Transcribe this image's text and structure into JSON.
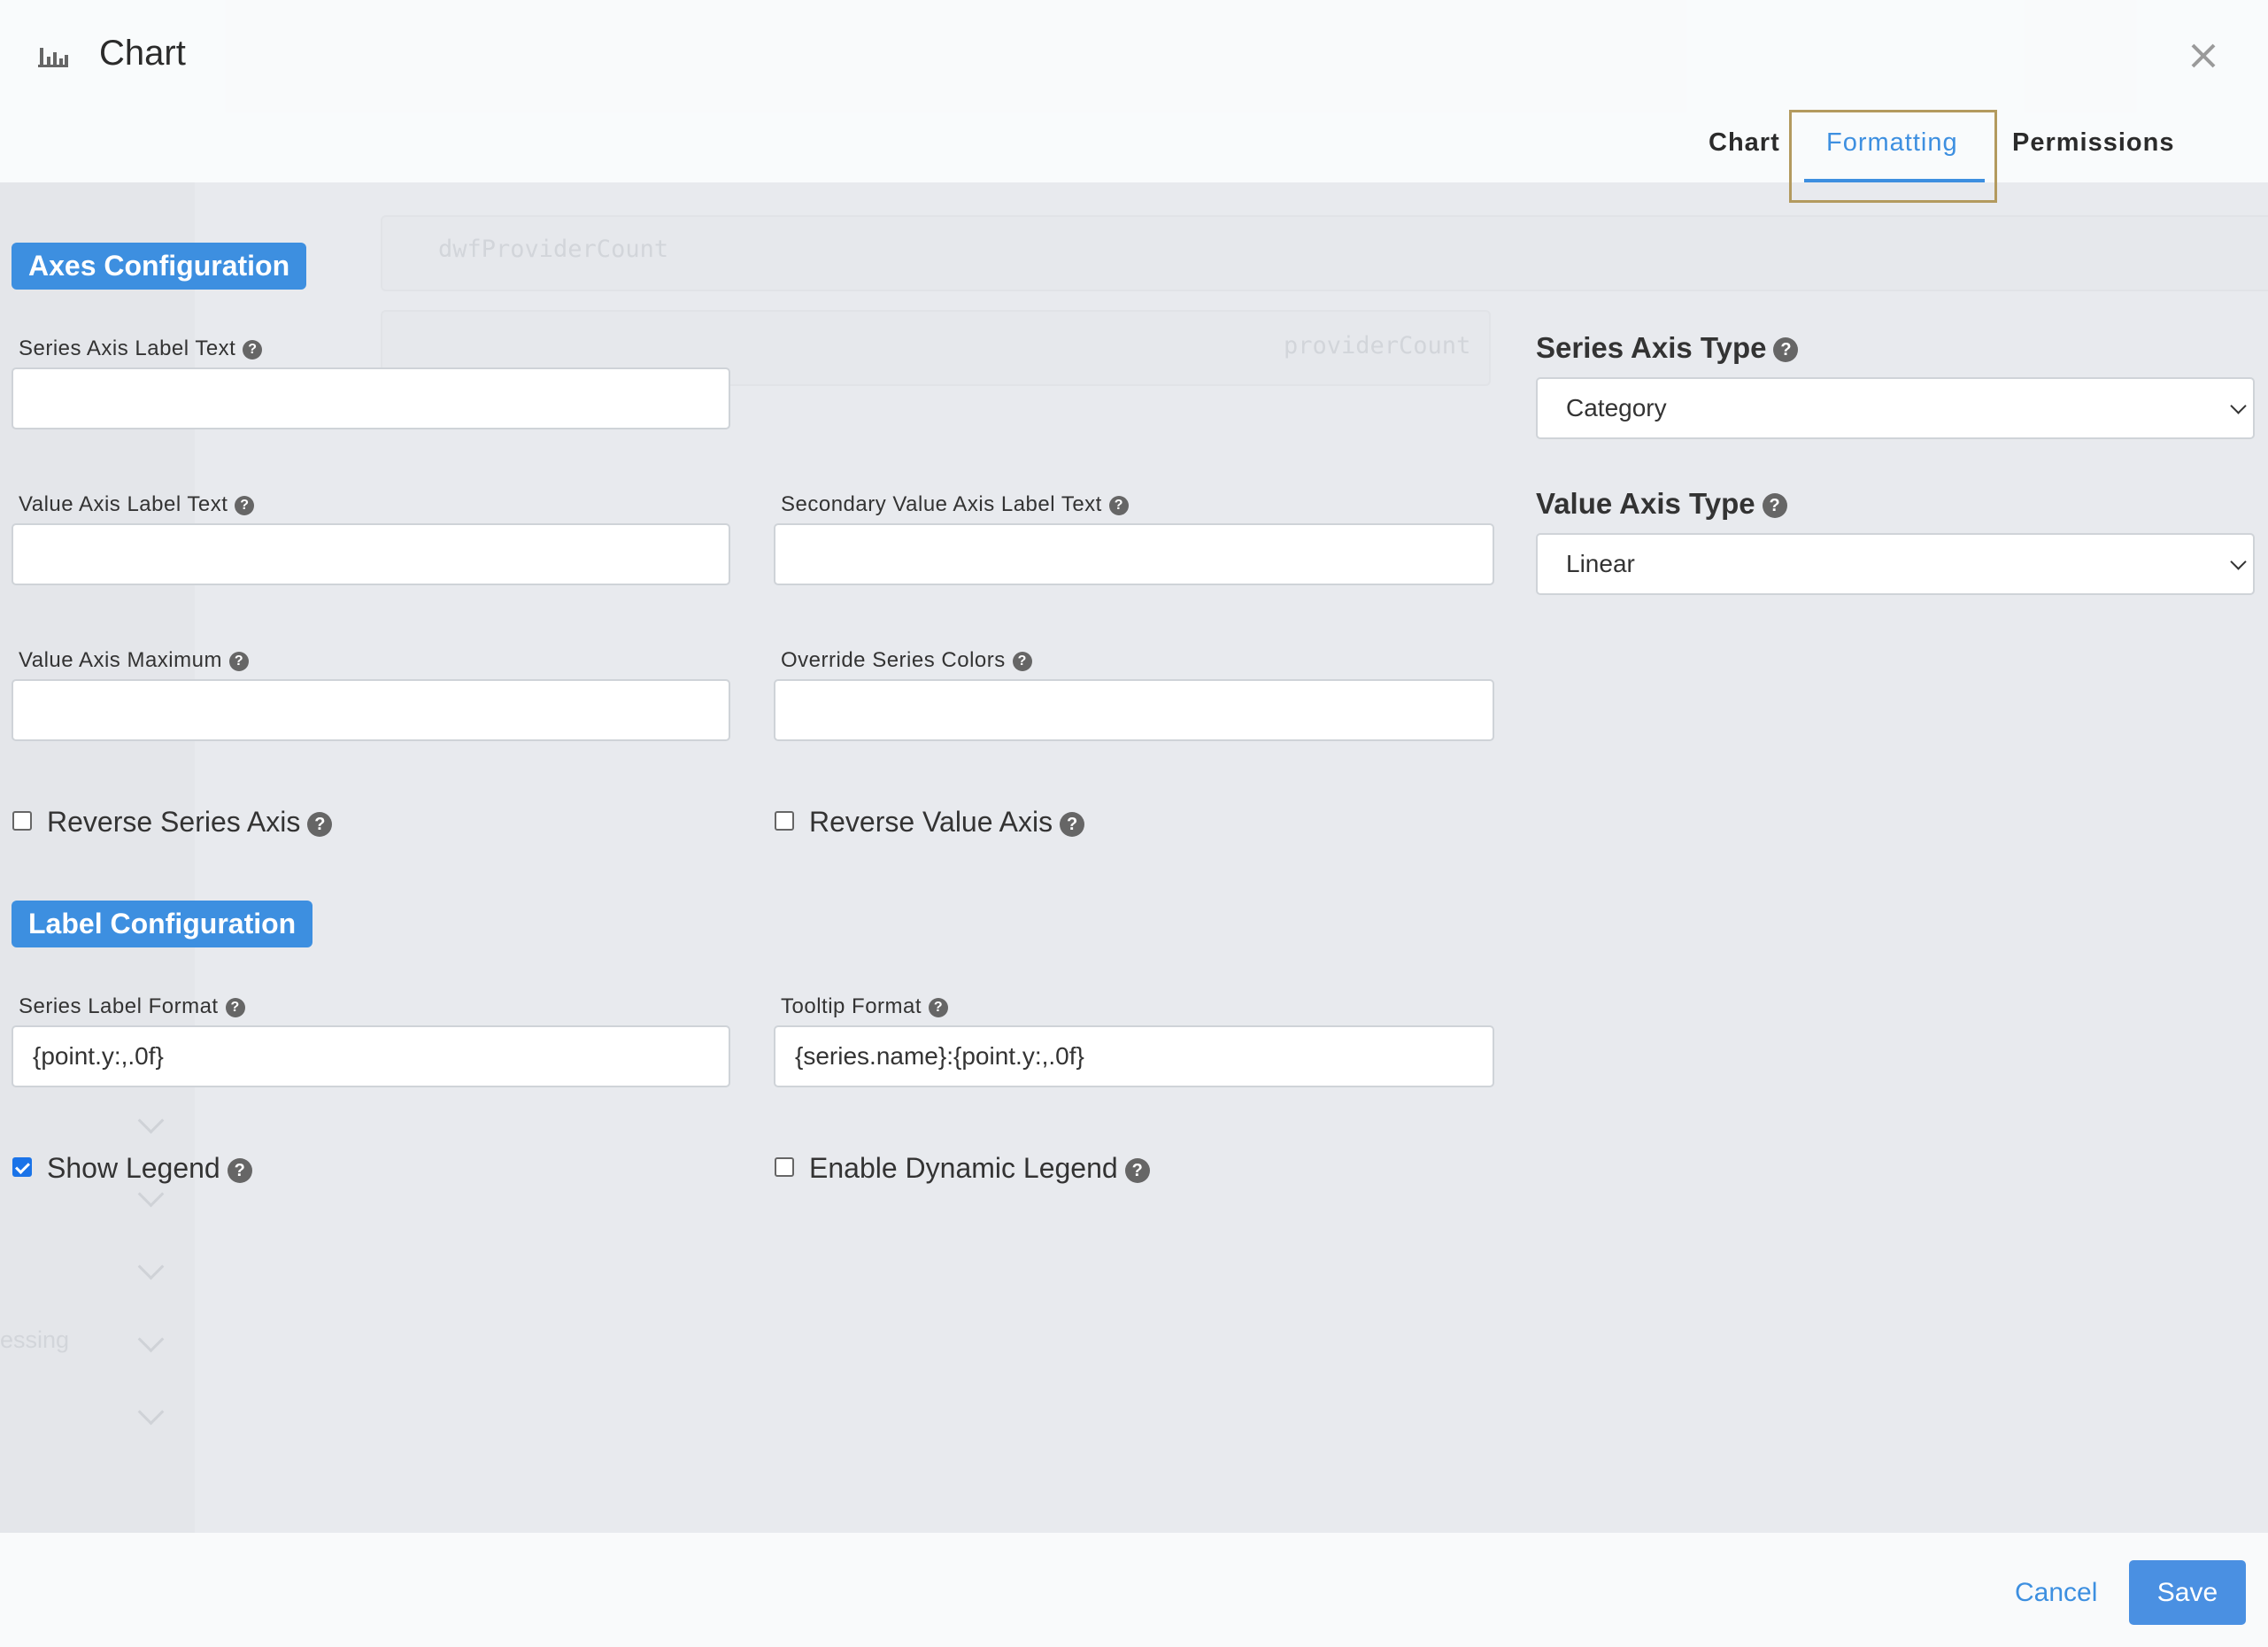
{
  "modal": {
    "title": "Chart",
    "close_label": "×"
  },
  "tabs": [
    {
      "label": "Chart",
      "active": false
    },
    {
      "label": "Formatting",
      "active": true
    },
    {
      "label": "Permissions",
      "active": false
    }
  ],
  "background": {
    "item_1": "dwfProviderCount",
    "item_2": "providerCount",
    "sidebar_partial": "essing"
  },
  "axes_section": {
    "title": "Axes Configuration",
    "series_axis_label": {
      "label": "Series Axis Label Text",
      "value": ""
    },
    "value_axis_label": {
      "label": "Value Axis Label Text",
      "value": ""
    },
    "secondary_value_axis_label": {
      "label": "Secondary Value Axis Label Text",
      "value": ""
    },
    "value_axis_maximum": {
      "label": "Value Axis Maximum",
      "value": ""
    },
    "override_series_colors": {
      "label": "Override Series Colors",
      "value": ""
    },
    "reverse_series_axis": {
      "label": "Reverse Series Axis",
      "checked": false
    },
    "reverse_value_axis": {
      "label": "Reverse Value Axis",
      "checked": false
    },
    "series_axis_type": {
      "label": "Series Axis Type",
      "value": "Category"
    },
    "value_axis_type": {
      "label": "Value Axis Type",
      "value": "Linear"
    }
  },
  "label_section": {
    "title": "Label Configuration",
    "series_label_format": {
      "label": "Series Label Format",
      "value": "{point.y:,.0f}"
    },
    "tooltip_format": {
      "label": "Tooltip Format",
      "value": "{series.name}:{point.y:,.0f}"
    },
    "show_legend": {
      "label": "Show Legend",
      "checked": true
    },
    "enable_dynamic_legend": {
      "label": "Enable Dynamic Legend",
      "checked": false
    }
  },
  "footer": {
    "cancel_label": "Cancel",
    "save_label": "Save"
  },
  "help_glyph": "?",
  "colors": {
    "accent": "#3d8fe0",
    "checkbox_checked": "#1a73e8",
    "tab_highlight": "#b39a5e"
  }
}
